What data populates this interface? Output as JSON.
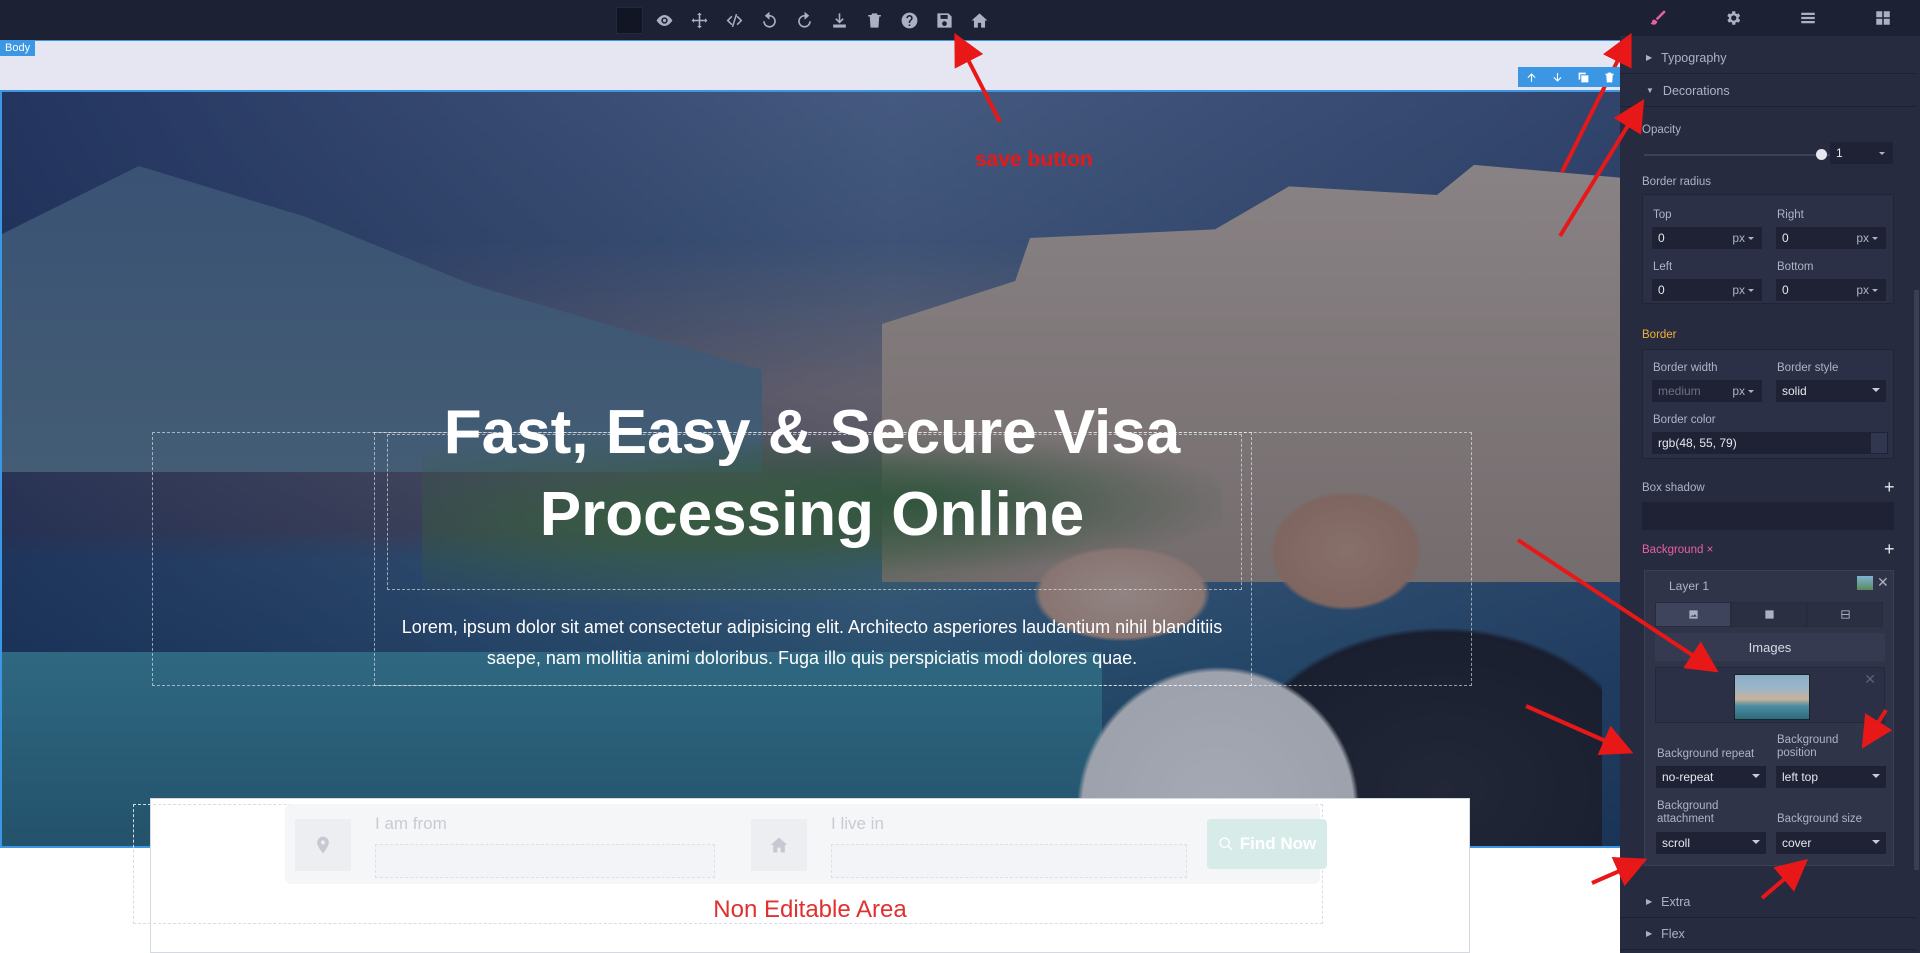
{
  "toolbar": {
    "icons": [
      "preview-icon",
      "move-icon",
      "code-icon",
      "undo-icon",
      "redo-icon",
      "download-icon",
      "trash-icon",
      "help-icon",
      "save-icon",
      "home-icon"
    ]
  },
  "canvas": {
    "body_badge": "Body",
    "hero": {
      "title_line1": "Fast, Easy & Secure Visa",
      "title_line2": "Processing Online",
      "text": "Lorem, ipsum dolor sit amet consectetur adipisicing elit. Architecto asperiores laudantium nihil blanditiis saepe, nam mollitia animi doloribus. Fuga illo quis perspiciatis modi dolores quae."
    },
    "search": {
      "from_label": "I am from",
      "live_label": "I live in",
      "button_label": "Find Now"
    },
    "non_editable": "Non Editable Area"
  },
  "annotation": {
    "save_text": "save button",
    "arrow_color": "#e81818"
  },
  "panel": {
    "sections": {
      "typography": "Typography",
      "decorations": "Decorations",
      "extra": "Extra",
      "flex": "Flex"
    },
    "opacity": {
      "label": "Opacity",
      "value": "1"
    },
    "border_radius": {
      "label": "Border radius",
      "top_label": "Top",
      "top_value": "0",
      "right_label": "Right",
      "right_value": "0",
      "left_label": "Left",
      "left_value": "0",
      "bottom_label": "Bottom",
      "bottom_value": "0",
      "unit": "px"
    },
    "border": {
      "label": "Border",
      "width_label": "Border width",
      "width_placeholder": "medium",
      "width_unit": "px",
      "style_label": "Border style",
      "style_value": "solid",
      "color_label": "Border color",
      "color_value": "rgb(48, 55, 79)"
    },
    "box_shadow": {
      "label": "Box shadow"
    },
    "background": {
      "label": "Background",
      "clear": "×",
      "layer_name": "Layer 1",
      "images_title": "Images",
      "repeat_label": "Background repeat",
      "repeat_value": "no-repeat",
      "position_label_1": "Background",
      "position_label_2": "position",
      "position_value": "left top",
      "attachment_label_1": "Background",
      "attachment_label_2": "attachment",
      "attachment_value": "scroll",
      "size_label": "Background size",
      "size_value": "cover"
    },
    "colors": {
      "accent": "#3b97e3",
      "style_tab": "#e95fa8",
      "border_label": "#f0b03c"
    }
  }
}
